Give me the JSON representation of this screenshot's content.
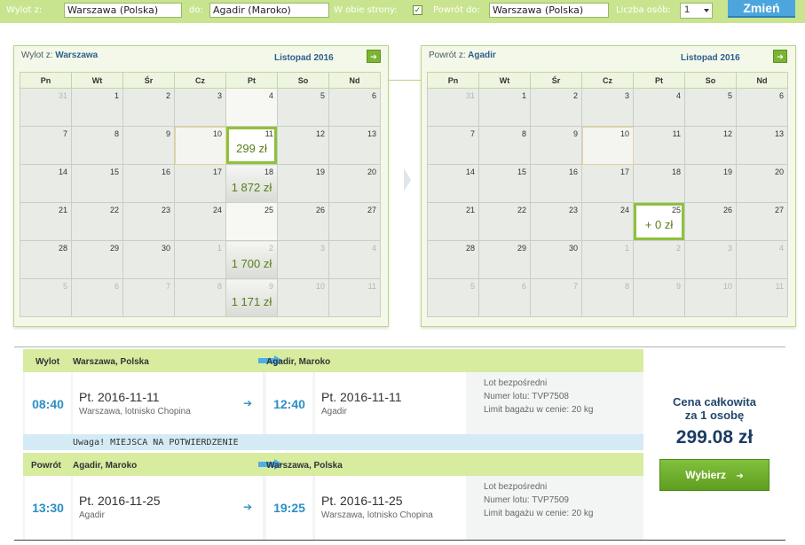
{
  "search": {
    "from_label": "Wylot z:",
    "from_value": "Warszawa (Polska)",
    "to_label": "do:",
    "to_value": "Agadir (Maroko)",
    "roundtrip_label": "W obie strony:",
    "roundtrip_checked": true,
    "return_label": "Powrót do:",
    "return_value": "Warszawa (Polska)",
    "persons_label": "Liczba osób:",
    "persons_value": "1",
    "change_button": "Zmień"
  },
  "weekdays": [
    "Pn",
    "Wt",
    "Śr",
    "Cz",
    "Pt",
    "So",
    "Nd"
  ],
  "outbound_calendar": {
    "route_prefix": "Wylot z:",
    "route_city": "Warszawa",
    "month": "Listopad 2016",
    "rows": [
      [
        {
          "d": "31",
          "s": "dim"
        },
        {
          "d": "1"
        },
        {
          "d": "2"
        },
        {
          "d": "3"
        },
        {
          "d": "4",
          "s": "bright"
        },
        {
          "d": "5"
        },
        {
          "d": "6"
        }
      ],
      [
        {
          "d": "7"
        },
        {
          "d": "8"
        },
        {
          "d": "9"
        },
        {
          "d": "10",
          "s": "today"
        },
        {
          "d": "11",
          "p": "299 zł",
          "s": "sel"
        },
        {
          "d": "12"
        },
        {
          "d": "13"
        }
      ],
      [
        {
          "d": "14"
        },
        {
          "d": "15"
        },
        {
          "d": "16"
        },
        {
          "d": "17"
        },
        {
          "d": "18",
          "p": "1 872 zł",
          "s": "price"
        },
        {
          "d": "19"
        },
        {
          "d": "20"
        }
      ],
      [
        {
          "d": "21"
        },
        {
          "d": "22"
        },
        {
          "d": "23"
        },
        {
          "d": "24"
        },
        {
          "d": "25",
          "s": "bright"
        },
        {
          "d": "26"
        },
        {
          "d": "27"
        }
      ],
      [
        {
          "d": "28"
        },
        {
          "d": "29"
        },
        {
          "d": "30"
        },
        {
          "d": "1",
          "s": "dim"
        },
        {
          "d": "2",
          "p": "1 700 zł",
          "s": "price dim"
        },
        {
          "d": "3",
          "s": "dim"
        },
        {
          "d": "4",
          "s": "dim"
        }
      ],
      [
        {
          "d": "5",
          "s": "dim"
        },
        {
          "d": "6",
          "s": "dim"
        },
        {
          "d": "7",
          "s": "dim"
        },
        {
          "d": "8",
          "s": "dim"
        },
        {
          "d": "9",
          "p": "1 171 zł",
          "s": "price dim"
        },
        {
          "d": "10",
          "s": "dim"
        },
        {
          "d": "11",
          "s": "dim"
        }
      ]
    ]
  },
  "return_calendar": {
    "route_prefix": "Powrót z:",
    "route_city": "Agadir",
    "month": "Listopad 2016",
    "rows": [
      [
        {
          "d": "31",
          "s": "dim"
        },
        {
          "d": "1"
        },
        {
          "d": "2"
        },
        {
          "d": "3"
        },
        {
          "d": "4"
        },
        {
          "d": "5"
        },
        {
          "d": "6"
        }
      ],
      [
        {
          "d": "7"
        },
        {
          "d": "8"
        },
        {
          "d": "9"
        },
        {
          "d": "10",
          "s": "today"
        },
        {
          "d": "11"
        },
        {
          "d": "12"
        },
        {
          "d": "13"
        }
      ],
      [
        {
          "d": "14"
        },
        {
          "d": "15"
        },
        {
          "d": "16"
        },
        {
          "d": "17"
        },
        {
          "d": "18"
        },
        {
          "d": "19"
        },
        {
          "d": "20"
        }
      ],
      [
        {
          "d": "21"
        },
        {
          "d": "22"
        },
        {
          "d": "23"
        },
        {
          "d": "24"
        },
        {
          "d": "25",
          "p": "+ 0 zł",
          "s": "sel"
        },
        {
          "d": "26"
        },
        {
          "d": "27"
        }
      ],
      [
        {
          "d": "28"
        },
        {
          "d": "29"
        },
        {
          "d": "30"
        },
        {
          "d": "1",
          "s": "dim"
        },
        {
          "d": "2",
          "s": "dim"
        },
        {
          "d": "3",
          "s": "dim"
        },
        {
          "d": "4",
          "s": "dim"
        }
      ],
      [
        {
          "d": "5",
          "s": "dim"
        },
        {
          "d": "6",
          "s": "dim"
        },
        {
          "d": "7",
          "s": "dim"
        },
        {
          "d": "8",
          "s": "dim"
        },
        {
          "d": "9",
          "s": "dim"
        },
        {
          "d": "10",
          "s": "dim"
        },
        {
          "d": "11",
          "s": "dim"
        }
      ]
    ]
  },
  "outbound_leg": {
    "label": "Wylot",
    "from": "Warszawa, Polska",
    "to": "Agadir, Maroko",
    "dep_time": "08:40",
    "dep_date": "Pt. 2016-11-11",
    "dep_airport": "Warszawa, lotnisko Chopina",
    "arr_time": "12:40",
    "arr_date": "Pt. 2016-11-11",
    "arr_airport": "Agadir",
    "info_direct": "Lot bezpośredni",
    "info_flight": "Numer lotu: TVP7508",
    "info_baggage": "Limit bagażu w cenie: 20 kg"
  },
  "warning": "Uwaga! MIEJSCA NA POTWIERDZENIE",
  "return_leg": {
    "label": "Powrót",
    "from": "Agadir, Maroko",
    "to": "Warszawa, Polska",
    "dep_time": "13:30",
    "dep_date": "Pt. 2016-11-25",
    "dep_airport": "Agadir",
    "arr_time": "19:25",
    "arr_date": "Pt. 2016-11-25",
    "arr_airport": "Warszawa, lotnisko Chopina",
    "info_direct": "Lot bezpośredni",
    "info_flight": "Numer lotu: TVP7509",
    "info_baggage": "Limit bagażu w cenie: 20 kg"
  },
  "total": {
    "label_line1": "Cena całkowita",
    "label_line2": "za 1 osobę",
    "value": "299.08 zł",
    "button": "Wybierz"
  },
  "colors": {
    "accent_green": "#8ec13c",
    "header_green": "#c9e48f",
    "accent_blue": "#4ca6dd",
    "price_text": "#5a7d1a"
  },
  "icons": {
    "next_month": "arrow-right-icon",
    "route_arrow": "route-arrow-icon",
    "small_arrow": "chevron-right-icon"
  }
}
